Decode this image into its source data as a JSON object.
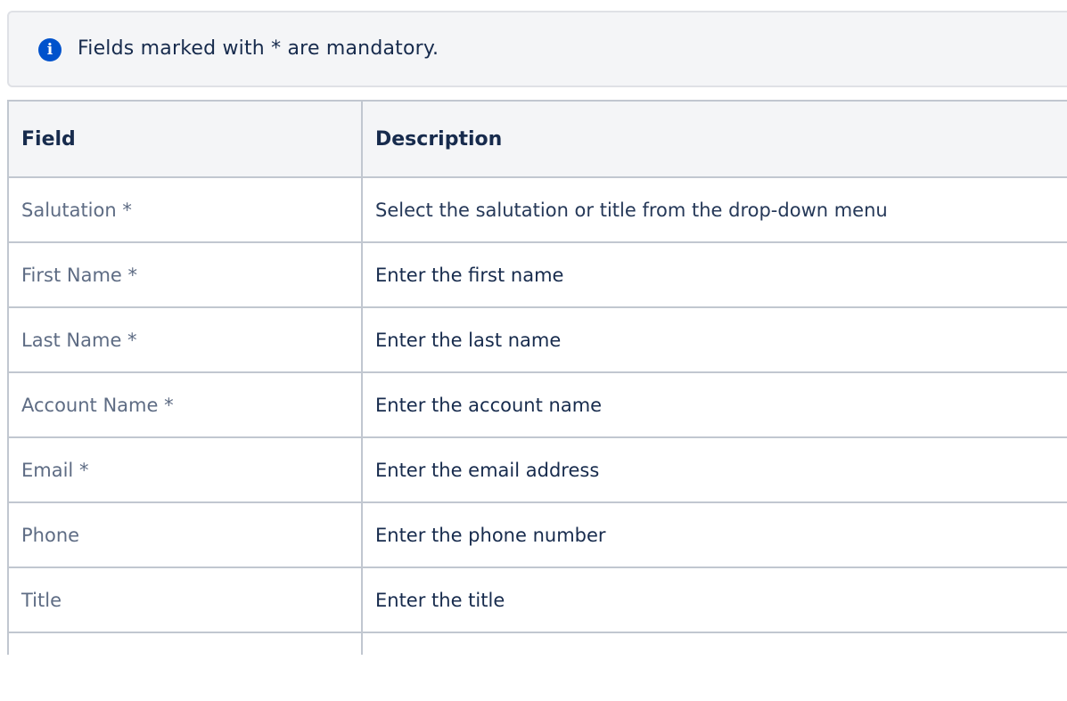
{
  "info": {
    "icon": "info-icon",
    "text": "Fields marked with * are mandatory."
  },
  "table": {
    "headers": {
      "field": "Field",
      "description": "Description"
    },
    "rows": [
      {
        "field": "Salutation *",
        "description": "Select the salutation or title from the drop-down menu"
      },
      {
        "field": "First Name *",
        "description": "Enter the first name"
      },
      {
        "field": "Last Name *",
        "description": "Enter the last name"
      },
      {
        "field": "Account Name *",
        "description": "Enter the account name"
      },
      {
        "field": "Email *",
        "description": "Enter the email address"
      },
      {
        "field": "Phone",
        "description": "Enter the phone number"
      },
      {
        "field": "Title",
        "description": "Enter the title"
      }
    ]
  },
  "colors": {
    "accent": "#0052cc",
    "text": "#172b4d",
    "muted": "#5e6c84",
    "border": "#c1c7d0",
    "panel": "#f4f5f7"
  }
}
